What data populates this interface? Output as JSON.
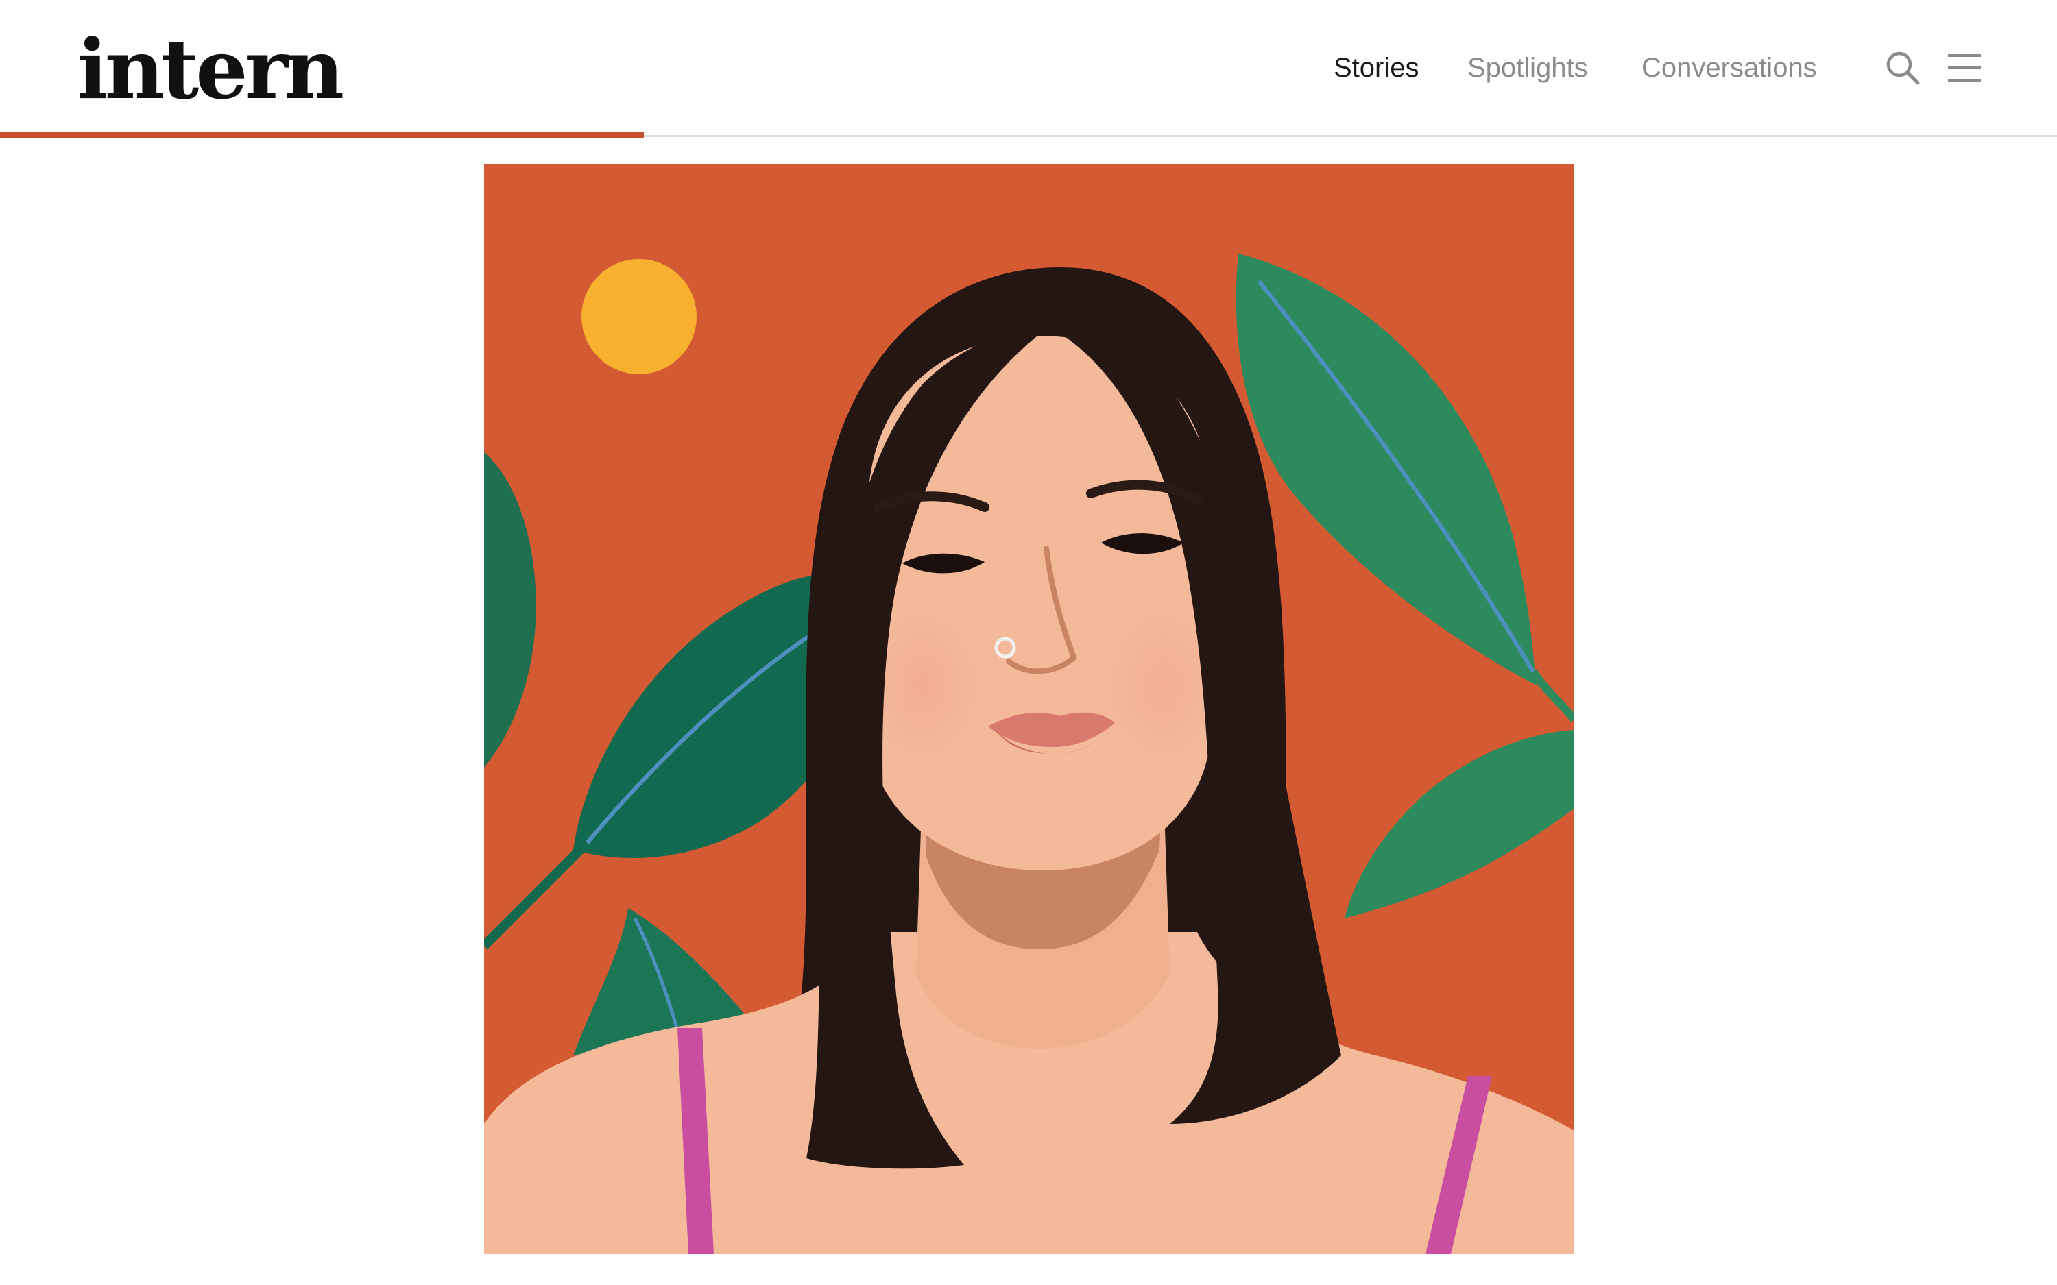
{
  "site": {
    "logo_text": "intern"
  },
  "nav": {
    "items": [
      {
        "label": "Stories",
        "active": true
      },
      {
        "label": "Spotlights",
        "active": false
      },
      {
        "label": "Conversations",
        "active": false
      }
    ]
  },
  "icons": {
    "search": "search-icon",
    "menu": "hamburger-menu-icon"
  },
  "reading_progress": 0.313,
  "colors": {
    "accent": "#c9502e",
    "illustration_background": "#d35a33",
    "leaf_green": "#2f8a5a",
    "sun_yellow": "#f7b12e",
    "hair": "#241612",
    "skin": "#f3b999",
    "strap_pink": "#c94ea0"
  }
}
